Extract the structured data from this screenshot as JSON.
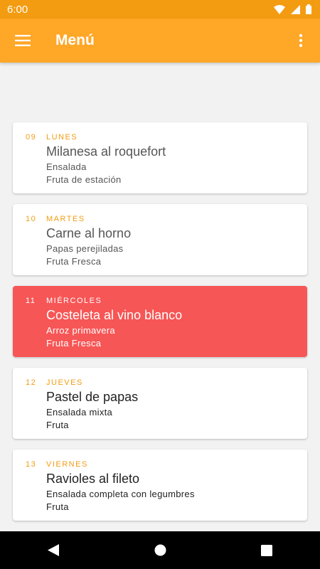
{
  "status_bar": {
    "time": "6:00"
  },
  "app_bar": {
    "title": "Menú"
  },
  "menu": [
    {
      "day": "09",
      "weekday": "Lunes",
      "main": "Milanesa al roquefort",
      "side": "Ensalada",
      "dessert": "Fruta de estación"
    },
    {
      "day": "10",
      "weekday": "Martes",
      "main": "Carne al horno",
      "side": "Papas perejiladas",
      "dessert": "Fruta Fresca"
    },
    {
      "day": "11",
      "weekday": "Miércoles",
      "main": "Costeleta al vino blanco",
      "side": "Arroz primavera",
      "dessert": "Fruta Fresca"
    },
    {
      "day": "12",
      "weekday": "Jueves",
      "main": "Pastel de papas",
      "side": "Ensalada mixta",
      "dessert": "Fruta"
    },
    {
      "day": "13",
      "weekday": "Viernes",
      "main": "Ravioles al fileto",
      "side": "Ensalada completa con legumbres",
      "dessert": "Fruta"
    }
  ],
  "colors": {
    "accent": "#ffa726",
    "status": "#f39c12",
    "highlight": "#f75656"
  },
  "icons": {
    "menu": "hamburger-icon",
    "more": "more-vert-icon",
    "back": "back-icon",
    "home": "home-icon",
    "recents": "recents-icon"
  }
}
